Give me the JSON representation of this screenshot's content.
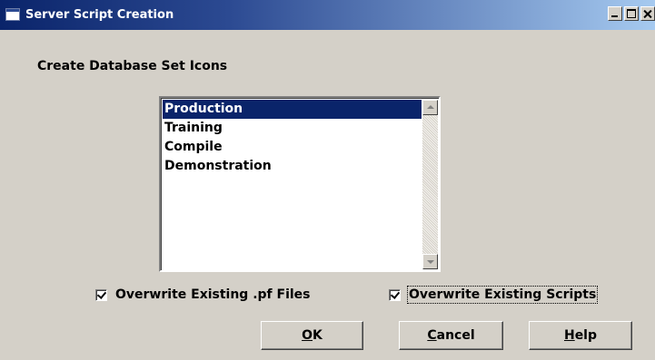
{
  "window": {
    "title": "Server Script Creation",
    "controls": [
      "minimize",
      "maximize",
      "close"
    ]
  },
  "heading": "Create Database Set Icons",
  "database_sets": {
    "items": [
      "Production",
      "Training",
      "Compile",
      "Demonstration"
    ],
    "selected": "Production"
  },
  "options": {
    "overwrite_pf": {
      "label": "Overwrite Existing .pf Files",
      "checked": true
    },
    "overwrite_scripts": {
      "label": "Overwrite Existing Scripts",
      "checked": true
    }
  },
  "buttons": {
    "ok": {
      "mnemonic": "O",
      "rest": "K"
    },
    "cancel": {
      "mnemonic": "C",
      "rest": "ancel"
    },
    "help": {
      "mnemonic": "H",
      "rest": "elp"
    }
  }
}
